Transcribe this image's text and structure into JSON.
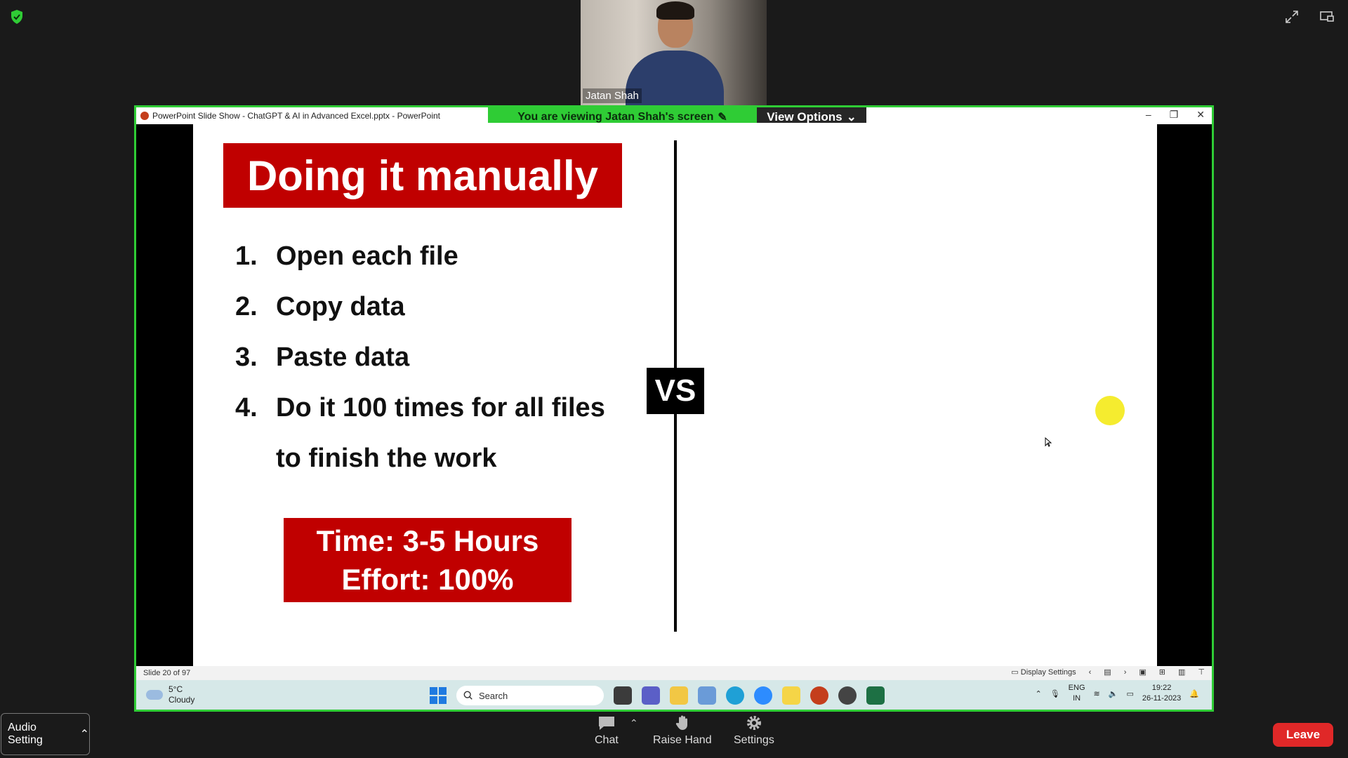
{
  "meeting": {
    "participant_name": "Jatan Shah",
    "viewing_banner": "You are viewing  Jatan Shah's screen",
    "view_options_label": "View Options"
  },
  "powerpoint": {
    "window_title": "PowerPoint Slide Show  -  ChatGPT & AI in Advanced Excel.pptx - PowerPoint",
    "status": "Slide 20 of 97",
    "display_settings": "Display Settings"
  },
  "slide": {
    "title": "Doing it manually",
    "steps": [
      {
        "num": "1.",
        "text": "Open each file"
      },
      {
        "num": "2.",
        "text": "Copy data"
      },
      {
        "num": "3.",
        "text": "Paste data"
      },
      {
        "num": "4.",
        "text": "Do it 100 times for all files to finish the work"
      }
    ],
    "time_line": "Time: 3-5 Hours",
    "effort_line": "Effort: 100%",
    "vs_label": "VS"
  },
  "taskbar": {
    "temperature": "5°C",
    "weather": "Cloudy",
    "search_placeholder": "Search",
    "lang_top": "ENG",
    "lang_bottom": "IN",
    "time": "19:22",
    "date": "26-11-2023"
  },
  "controls": {
    "audio_setting": "Audio Setting",
    "chat": "Chat",
    "raise_hand": "Raise Hand",
    "settings": "Settings",
    "leave": "Leave"
  },
  "colors": {
    "accent_green": "#2fcc35",
    "slide_red": "#c00000",
    "leave_red": "#e02828"
  }
}
